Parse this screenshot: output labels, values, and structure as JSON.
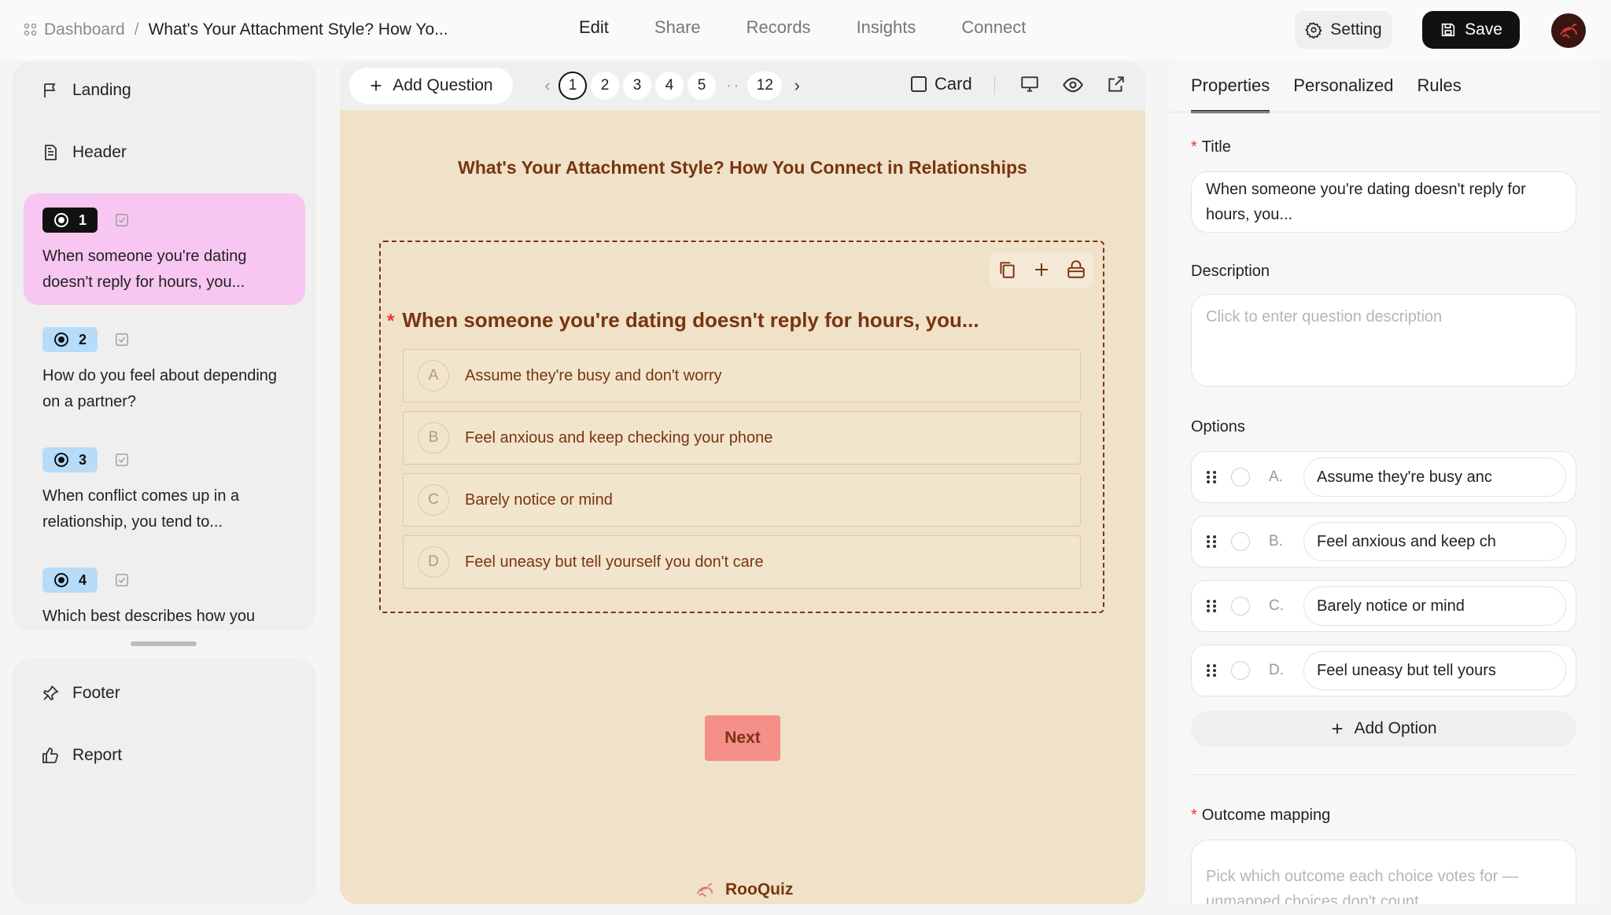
{
  "breadcrumb": {
    "root": "Dashboard",
    "separator": "/",
    "current": "What's Your Attachment Style? How Yo..."
  },
  "topnav": [
    "Edit",
    "Share",
    "Records",
    "Insights",
    "Connect"
  ],
  "header_actions": {
    "setting": "Setting",
    "save": "Save"
  },
  "sidebar": {
    "landing": "Landing",
    "header": "Header",
    "questions": [
      {
        "number": "1",
        "text": "When someone you're dating doesn't reply for hours, you..."
      },
      {
        "number": "2",
        "text": "How do you feel about depending on a partner?"
      },
      {
        "number": "3",
        "text": "When conflict comes up in a relationship, you tend to..."
      },
      {
        "number": "4",
        "text": "Which best describes how you"
      }
    ],
    "footer": "Footer",
    "report": "Report"
  },
  "toolbar": {
    "add_question": "Add Question",
    "pages": [
      "1",
      "2",
      "3",
      "4",
      "5"
    ],
    "dots": "··",
    "last_page": "12",
    "card": "Card"
  },
  "canvas": {
    "quiz_title": "What's Your Attachment Style? How You Connect in Relationships",
    "required_mark": "*",
    "question": "When someone you're dating doesn't reply for hours, you...",
    "options": [
      {
        "letter": "A",
        "text": "Assume they're busy and don't worry"
      },
      {
        "letter": "B",
        "text": "Feel anxious and keep checking your phone"
      },
      {
        "letter": "C",
        "text": "Barely notice or mind"
      },
      {
        "letter": "D",
        "text": "Feel uneasy but tell yourself you don't care"
      }
    ],
    "next": "Next",
    "brand": "RooQuiz"
  },
  "properties": {
    "tabs": [
      "Properties",
      "Personalized",
      "Rules"
    ],
    "title_label": "Title",
    "title_value": "When someone you're dating doesn't reply for hours, you...",
    "description_label": "Description",
    "description_placeholder": "Click to enter question description",
    "options_label": "Options",
    "options": [
      {
        "label": "A.",
        "value": "Assume they're busy anc"
      },
      {
        "label": "B.",
        "value": "Feel anxious and keep ch"
      },
      {
        "label": "C.",
        "value": "Barely notice or mind"
      },
      {
        "label": "D.",
        "value": "Feel uneasy but tell yours"
      }
    ],
    "add_option": "Add Option",
    "outcome_label": "Outcome mapping",
    "outcome_placeholder": "Pick which outcome each choice votes for — unmapped choices don't count"
  },
  "colors": {
    "canvas_bg": "#efe2c8",
    "accent_text": "#7a3411",
    "active_question_bg": "#f7c6f1",
    "badge_light": "#b7dcfa",
    "next_button": "#f58f8a"
  }
}
